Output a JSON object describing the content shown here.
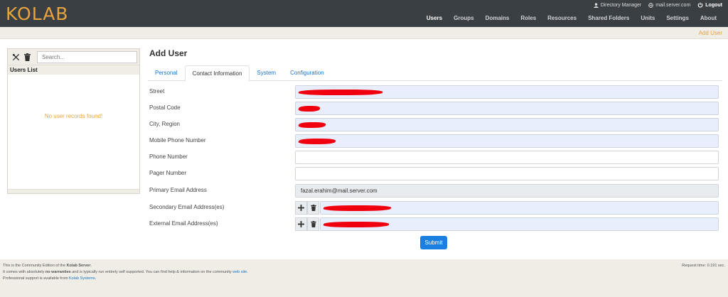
{
  "header": {
    "logo": "KOLAB",
    "user": "Directory Manager",
    "domain": "mail.server.com",
    "logout": "Logout",
    "nav": [
      "Users",
      "Groups",
      "Domains",
      "Roles",
      "Resources",
      "Shared Folders",
      "Units",
      "Settings",
      "About"
    ],
    "active_nav": "Users",
    "action": "Add User"
  },
  "sidebar": {
    "search_placeholder": "Search...",
    "title": "Users List",
    "empty": "No user records found!"
  },
  "form": {
    "title": "Add User",
    "tabs": [
      "Personal",
      "Contact Information",
      "System",
      "Configuration"
    ],
    "active_tab": "Contact Information",
    "fields": [
      {
        "label": "Street",
        "value": ""
      },
      {
        "label": "Postal Code",
        "value": ""
      },
      {
        "label": "City, Region",
        "value": ""
      },
      {
        "label": "Mobile Phone Number",
        "value": ""
      },
      {
        "label": "Phone Number",
        "value": ""
      },
      {
        "label": "Pager Number",
        "value": ""
      },
      {
        "label": "Primary Email Address",
        "value": "fazal.erahim@mail.server.com"
      },
      {
        "label": "Secondary Email Address(es)",
        "value": ""
      },
      {
        "label": "External Email Address(es)",
        "value": ""
      }
    ],
    "submit": "Submit"
  },
  "footer": {
    "line1_pre": "This is the Community Edition of the ",
    "line1_bold": "Kolab Server",
    "line1_post": ".",
    "line2_pre": "It comes with absolutely ",
    "line2_bold": "no warranties",
    "line2_mid": " and is typically run entirely self supported. You can find help & information on the community ",
    "line2_link": "web site",
    "line2_post": ".",
    "line3_pre": "Professional support is available from ",
    "line3_link": "Kolab Systems",
    "line3_post": ".",
    "request_time": "Request time: 0.191 sec."
  },
  "colors": {
    "header_bg": "#3a3f44",
    "accent": "#e8a33d",
    "link": "#1a73c9",
    "submit": "#1a7fe0",
    "redaction": "#f0000f"
  }
}
